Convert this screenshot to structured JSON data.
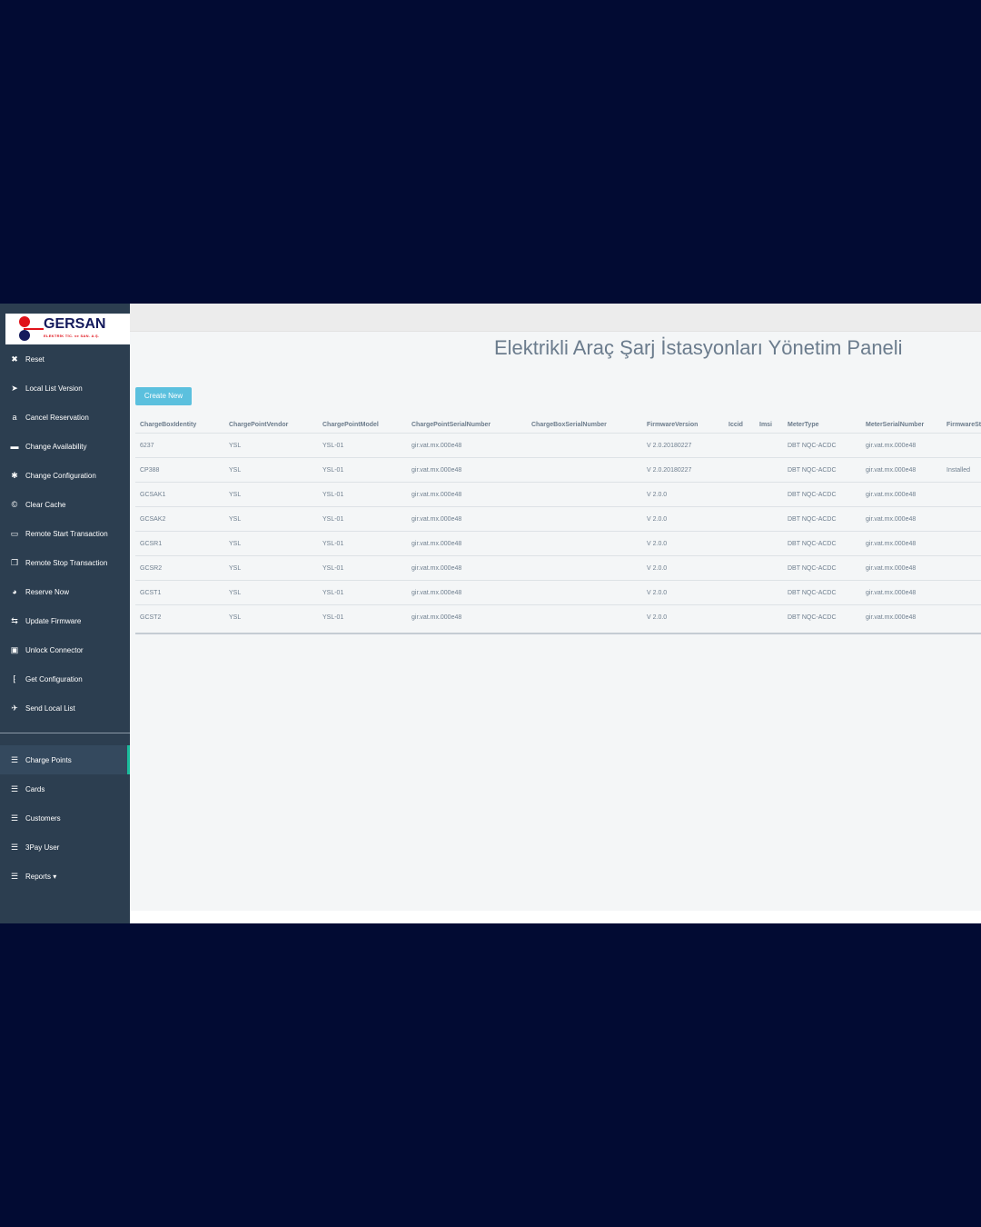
{
  "logo": {
    "brand": "GERSAN",
    "sub": "ELEKTRİK TİC. ve SAN. A.Ş."
  },
  "sidebar": {
    "actions": [
      {
        "label": "Reset",
        "icon": "✖",
        "icon_name": "close-icon"
      },
      {
        "label": "Local List Version",
        "icon": "➤",
        "icon_name": "send-icon"
      },
      {
        "label": "Cancel Reservation",
        "icon": "a",
        "icon_name": "amazon-icon"
      },
      {
        "label": "Change Availability",
        "icon": "▬",
        "icon_name": "window-icon"
      },
      {
        "label": "Change Configuration",
        "icon": "✱",
        "icon_name": "puzzle-icon"
      },
      {
        "label": "Clear Cache",
        "icon": "©",
        "icon_name": "copyright-icon"
      },
      {
        "label": "Remote Start Transaction",
        "icon": "▭",
        "icon_name": "desktop-icon"
      },
      {
        "label": "Remote Stop Transaction",
        "icon": "❐",
        "icon_name": "copy-icon"
      },
      {
        "label": "Reserve Now",
        "icon": "◕",
        "icon_name": "ubuntu-icon"
      },
      {
        "label": "Update Firmware",
        "icon": "⇆",
        "icon_name": "usb-icon"
      },
      {
        "label": "Unlock Connector",
        "icon": "▣",
        "icon_name": "unlock-icon"
      },
      {
        "label": "Get Configuration",
        "icon": "⁅",
        "icon_name": "bracket-icon"
      },
      {
        "label": "Send Local List",
        "icon": "✈",
        "icon_name": "paper-plane-icon"
      }
    ],
    "nav": [
      {
        "label": "Charge Points",
        "icon": "☰",
        "icon_name": "list-icon"
      },
      {
        "label": "Cards",
        "icon": "☰",
        "icon_name": "list-icon"
      },
      {
        "label": "Customers",
        "icon": "☰",
        "icon_name": "list-icon"
      },
      {
        "label": "3Pay User",
        "icon": "☰",
        "icon_name": "list-icon"
      },
      {
        "label": "Reports ▾",
        "icon": "☰",
        "icon_name": "list-icon"
      }
    ]
  },
  "header": {
    "title": "Elektrikli Araç Şarj İstasyonları Yönetim Paneli"
  },
  "toolbar": {
    "create_label": "Create New"
  },
  "table": {
    "columns": [
      "ChargeBoxIdentity",
      "ChargePointVendor",
      "ChargePointModel",
      "ChargePointSerialNumber",
      "ChargeBoxSerialNumber",
      "FirmwareVersion",
      "Iccid",
      "Imsi",
      "MeterType",
      "MeterSerialNumber",
      "FirmwareStatus"
    ],
    "rows": [
      [
        "6237",
        "YSL",
        "YSL-01",
        "gir.vat.mx.000e48",
        "",
        "V 2.0.20180227",
        "",
        "",
        "DBT NQC-ACDC",
        "gir.vat.mx.000e48",
        ""
      ],
      [
        "CP388",
        "YSL",
        "YSL-01",
        "gir.vat.mx.000e48",
        "",
        "V 2.0.20180227",
        "",
        "",
        "DBT NQC-ACDC",
        "gir.vat.mx.000e48",
        "Installed"
      ],
      [
        "GCSAK1",
        "YSL",
        "YSL-01",
        "gir.vat.mx.000e48",
        "",
        "V 2.0.0",
        "",
        "",
        "DBT NQC-ACDC",
        "gir.vat.mx.000e48",
        ""
      ],
      [
        "GCSAK2",
        "YSL",
        "YSL-01",
        "gir.vat.mx.000e48",
        "",
        "V 2.0.0",
        "",
        "",
        "DBT NQC-ACDC",
        "gir.vat.mx.000e48",
        ""
      ],
      [
        "GCSR1",
        "YSL",
        "YSL-01",
        "gir.vat.mx.000e48",
        "",
        "V 2.0.0",
        "",
        "",
        "DBT NQC-ACDC",
        "gir.vat.mx.000e48",
        ""
      ],
      [
        "GCSR2",
        "YSL",
        "YSL-01",
        "gir.vat.mx.000e48",
        "",
        "V 2.0.0",
        "",
        "",
        "DBT NQC-ACDC",
        "gir.vat.mx.000e48",
        ""
      ],
      [
        "GCST1",
        "YSL",
        "YSL-01",
        "gir.vat.mx.000e48",
        "",
        "V 2.0.0",
        "",
        "",
        "DBT NQC-ACDC",
        "gir.vat.mx.000e48",
        ""
      ],
      [
        "GCST2",
        "YSL",
        "YSL-01",
        "gir.vat.mx.000e48",
        "",
        "V 2.0.0",
        "",
        "",
        "DBT NQC-ACDC",
        "gir.vat.mx.000e48",
        ""
      ]
    ]
  },
  "colors": {
    "sidebar": "#2c3e50",
    "accent": "#5bc0de",
    "active_marker": "#1abc9c",
    "background": "#020b33"
  }
}
